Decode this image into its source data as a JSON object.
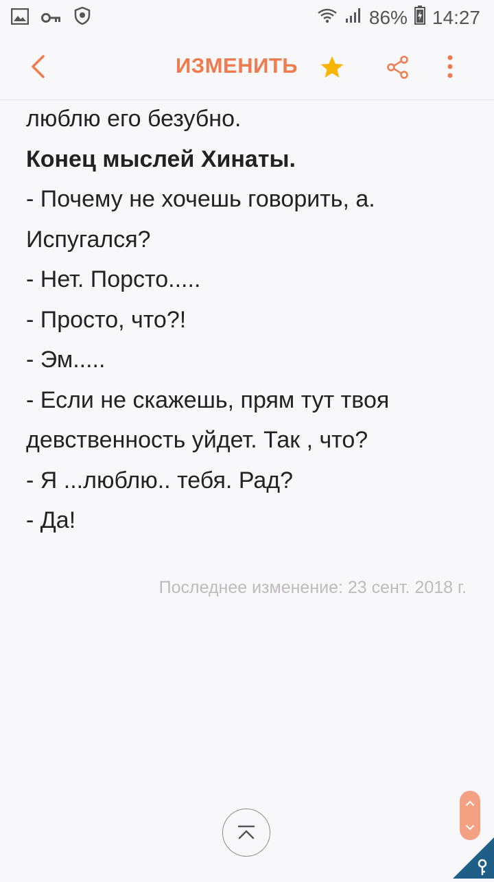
{
  "status_bar": {
    "battery": "86%",
    "time": "14:27",
    "icons": [
      "image-icon",
      "key-icon",
      "shield-icon",
      "wifi-icon",
      "signal-icon",
      "battery-icon"
    ]
  },
  "toolbar": {
    "edit_label": "ИЗМЕНИТЬ",
    "accent_color": "#ef7b4f",
    "star_color": "#f7b500",
    "icons": [
      "back-icon",
      "star-icon",
      "share-icon",
      "more-icon"
    ]
  },
  "note": {
    "lines": [
      "люблю его безубно.",
      "Конец мыслей Хинаты.",
      "- Почему не хочешь говорить, а.",
      "Испугался?",
      "- Нет. Порсто.....",
      "- Просто, что?!",
      "- Эм.....",
      "- Если не скажешь, прям тут твоя",
      "девственность уйдет. Так , что?",
      "- Я ...люблю.. тебя. Рад?",
      "- Да!"
    ],
    "last_modified": "Последнее изменение: 23 сент. 2018 г."
  },
  "controls": {
    "icons": [
      "scroll-to-top-icon",
      "page-up-icon",
      "page-down-icon"
    ]
  }
}
